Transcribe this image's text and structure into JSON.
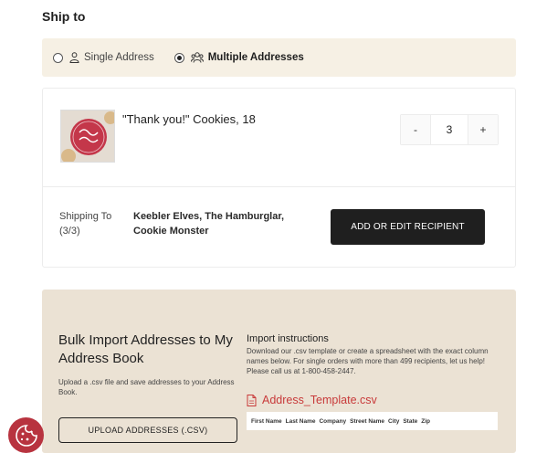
{
  "ship_to": {
    "title": "Ship to"
  },
  "address_mode": {
    "single_label": "Single Address",
    "multiple_label": "Multiple Addresses",
    "selected": "multiple"
  },
  "product": {
    "name": "\"Thank you!\" Cookies, 18",
    "quantity": "3",
    "decrement_label": "-",
    "increment_label": "+"
  },
  "shipping": {
    "label": "Shipping To (3/3)",
    "recipients": "Keebler Elves, The Hamburglar, Cookie Monster",
    "add_button_label": "ADD OR EDIT RECIPIENT"
  },
  "bulk_import": {
    "title": "Bulk Import Addresses to My Address Book",
    "subtitle": "Upload a .csv file and save addresses to your Address Book.",
    "upload_button_label": "UPLOAD ADDRESSES (.CSV)",
    "instructions_title": "Import instructions",
    "instructions_body": "Download our .csv template or create a spreadsheet with the exact column names below. For single orders with more than 499 recipients, let us help! Please call us at 1-800-458-2447.",
    "template_link": "Address_Template.csv",
    "columns": [
      "First Name",
      "Last Name",
      "Company",
      "Street Name",
      "City",
      "State",
      "Zip"
    ]
  },
  "colors": {
    "accent_red": "#c83a3a",
    "badge_red": "#b8333f",
    "dark_button": "#1f1f1f",
    "toggle_bg": "#f6f0e4",
    "bulk_bg": "#ebe2d4"
  },
  "icons": {
    "single": "person-icon",
    "multiple": "people-icon",
    "file": "file-icon",
    "badge": "cookie-icon"
  }
}
